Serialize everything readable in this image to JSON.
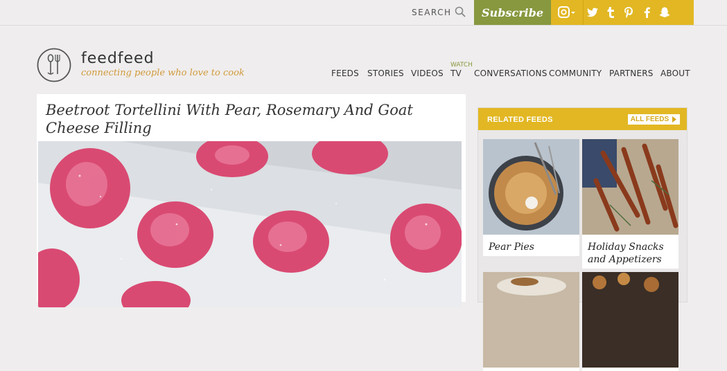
{
  "topbar": {
    "search_label": "SEARCH",
    "subscribe_label": "Subscribe",
    "social": [
      {
        "name": "instagram-icon",
        "glyph": "◻"
      },
      {
        "name": "twitter-icon",
        "glyph": "t"
      },
      {
        "name": "tumblr-icon",
        "glyph": "t"
      },
      {
        "name": "pinterest-icon",
        "glyph": "p"
      },
      {
        "name": "facebook-icon",
        "glyph": "f"
      },
      {
        "name": "snapchat-icon",
        "glyph": "☺"
      }
    ]
  },
  "brand": {
    "name": "feedfeed",
    "tagline": "connecting people who love to cook"
  },
  "nav": {
    "watch": "WATCH",
    "items": [
      "FEEDS",
      "STORIES",
      "VIDEOS",
      "TV",
      "CONVERSATIONS",
      "COMMUNITY",
      "PARTNERS",
      "ABOUT"
    ]
  },
  "article": {
    "title": "Beetroot Tortellini With Pear, Rosemary And Goat Cheese Filling"
  },
  "related": {
    "title": "RELATED FEEDS",
    "all_label": "ALL FEEDS",
    "cards": [
      {
        "label": "Pear Pies"
      },
      {
        "label": "Holiday Snacks and Appetizers"
      }
    ]
  },
  "colors": {
    "accent_green": "#87983f",
    "accent_yellow": "#e2b723",
    "tagline": "#d19a3c"
  }
}
